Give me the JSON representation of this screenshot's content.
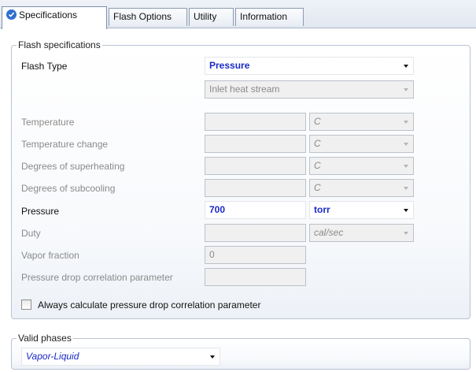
{
  "tabs": [
    {
      "label": "Specifications",
      "active": true,
      "status_icon": "check-circle-icon"
    },
    {
      "label": "Flash Options",
      "active": false
    },
    {
      "label": "Utility",
      "active": false
    },
    {
      "label": "Information",
      "active": false
    }
  ],
  "flash_specifications": {
    "title": "Flash specifications",
    "flash_type_label": "Flash Type",
    "flash_type_value": "Pressure",
    "flash_type_second_value": "Inlet heat stream",
    "rows": {
      "temperature": {
        "label": "Temperature",
        "value": "",
        "unit": "C",
        "enabled": false
      },
      "temperature_change": {
        "label": "Temperature change",
        "value": "",
        "unit": "C",
        "enabled": false
      },
      "superheating": {
        "label": "Degrees of superheating",
        "value": "",
        "unit": "C",
        "enabled": false
      },
      "subcooling": {
        "label": "Degrees of subcooling",
        "value": "",
        "unit": "C",
        "enabled": false
      },
      "pressure": {
        "label": "Pressure",
        "value": "700",
        "unit": "torr",
        "enabled": true
      },
      "duty": {
        "label": "Duty",
        "value": "",
        "unit": "cal/sec",
        "enabled": false
      },
      "vapor_fraction": {
        "label": "Vapor fraction",
        "value": "0",
        "enabled": false
      },
      "pressure_drop_param": {
        "label": "Pressure drop correlation parameter",
        "value": "",
        "enabled": false
      }
    },
    "always_calculate_checkbox": {
      "label": "Always calculate pressure drop correlation parameter",
      "checked": false
    }
  },
  "valid_phases": {
    "title": "Valid phases",
    "value": "Vapor-Liquid"
  },
  "colors": {
    "accent_text": "#1a2ac8",
    "disabled_text": "#8a8a8a",
    "tab_check": "#2f6fd0"
  }
}
